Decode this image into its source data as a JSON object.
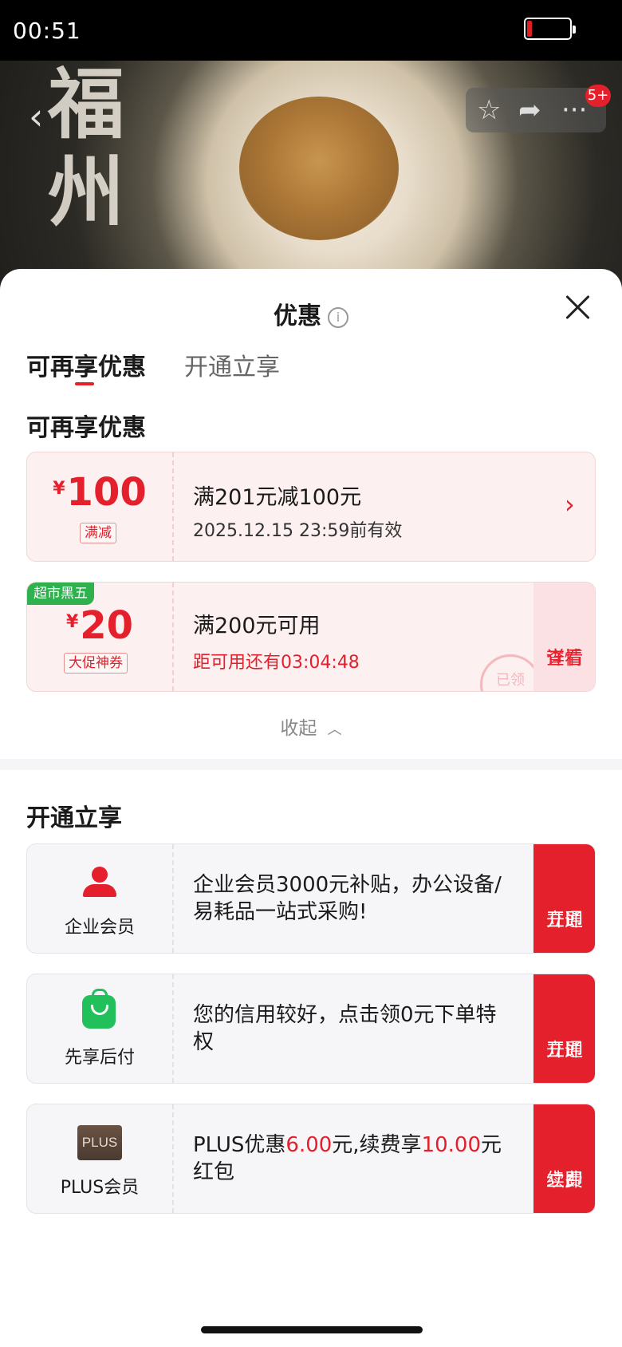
{
  "status_bar": {
    "time": "00:51"
  },
  "hero": {
    "calligraphy": "福州",
    "badge": "5+"
  },
  "sheet": {
    "title": "优惠",
    "info_glyph": "i",
    "tabs": [
      {
        "label": "可再享优惠",
        "active": true
      },
      {
        "label": "开通立享",
        "active": false
      }
    ],
    "section_available": "可再享优惠",
    "coupons": [
      {
        "currency": "¥",
        "amount": "100",
        "tag": "满减",
        "description": "满201元减100元",
        "subtitle": "2025.12.15 23:59前有效"
      },
      {
        "corner_tag": "超市黑五",
        "currency": "¥",
        "amount": "20",
        "tag": "大促神券",
        "description": "满200元可用",
        "subtitle": "距可用还有03:04:48",
        "action": "查看详情",
        "action_line1": "查看",
        "action_line2": "详情",
        "stamp": "已领"
      }
    ],
    "collapse_label": "收起",
    "section_membership": "开通立享",
    "memberships": [
      {
        "icon": "person-icon",
        "name": "企业会员",
        "description": "企业会员3000元补贴，办公设备/易耗品一站式采购!",
        "action_line1": "立即",
        "action_line2": "开通"
      },
      {
        "icon": "shopping-bag-icon",
        "name": "先享后付",
        "description": "您的信用较好，点击领0元下单特权",
        "action_line1": "立即",
        "action_line2": "开通"
      },
      {
        "icon": "plus-logo-icon",
        "logo_text": "PLUS",
        "name": "PLUS会员",
        "desc_part1": "PLUS优惠",
        "desc_amount1": "6.00",
        "desc_part2": "元,续费享",
        "desc_amount2": "10.00",
        "desc_part3": "元红包",
        "action_line1": "立即",
        "action_line2": "续费"
      }
    ]
  },
  "colors": {
    "accent": "#e3202b",
    "green": "#2fb24e",
    "coupon_bg": "#fdf0f0"
  }
}
